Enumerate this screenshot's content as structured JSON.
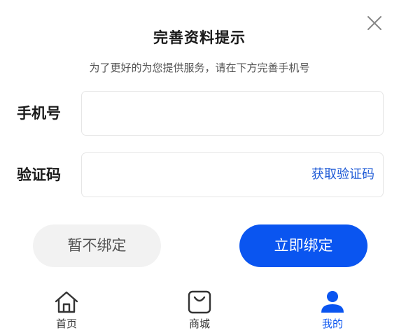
{
  "dialog": {
    "title": "完善资料提示",
    "subtitle": "为了更好的为您提供服务，请在下方完善手机号",
    "close_icon": "close-icon"
  },
  "form": {
    "phone": {
      "label": "手机号",
      "value": "",
      "placeholder": ""
    },
    "code": {
      "label": "验证码",
      "value": "",
      "placeholder": "",
      "get_code_label": "获取验证码"
    }
  },
  "actions": {
    "skip_label": "暂不绑定",
    "bind_label": "立即绑定"
  },
  "tabbar": {
    "items": [
      {
        "label": "首页",
        "icon": "home-icon",
        "active": false
      },
      {
        "label": "商城",
        "icon": "shopping-bag-icon",
        "active": false
      },
      {
        "label": "我的",
        "icon": "user-icon",
        "active": true
      }
    ]
  },
  "colors": {
    "primary": "#0a55f0",
    "link": "#1e5ad6",
    "secondary_button_bg": "#f2f2f2",
    "active_tab": "#0a55f0"
  }
}
